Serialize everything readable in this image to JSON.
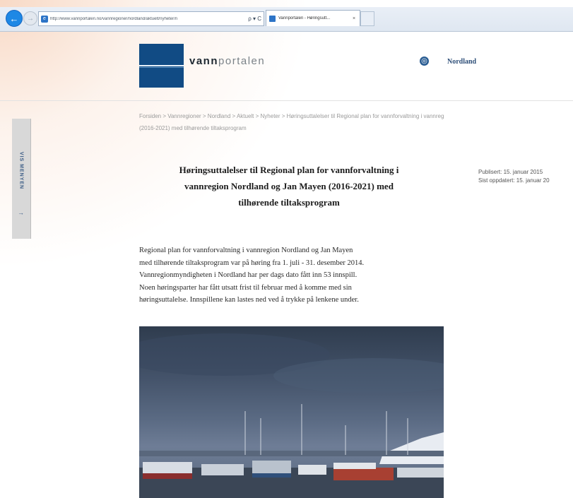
{
  "browser": {
    "url": "http://www.vannportalen.no/vannregioner/nordland/aktuelt/nyheter/n",
    "address_controls": "ρ ▾ C",
    "tab_title": "Vannportalen - Høringsutt...",
    "tab_close": "×"
  },
  "site": {
    "logo_bold": "vann",
    "logo_light": "portalen",
    "region": "Nordland"
  },
  "breadcrumb": {
    "line1": "Forsiden  >  Vannregioner  >  Nordland  >  Aktuelt  >  Nyheter  >  Høringsuttalelser til Regional plan for vannforvaltning i vannreg",
    "line2": "(2016-2021) med tilhørende tiltaksprogram"
  },
  "side_menu": {
    "label": "VIS MENYEN",
    "arrow": "→"
  },
  "article": {
    "title_lines": [
      "Høringsuttalelser til Regional plan for vannforvaltning i",
      "vannregion Nordland og Jan Mayen (2016-2021) med",
      "tilhørende tiltaksprogram"
    ],
    "published": "Publisert: 15. januar 2015",
    "updated": "Sist oppdatert: 15. januar 20",
    "body_lines": [
      "Regional plan for vannforvaltning i vannregion Nordland og Jan Mayen",
      "med tilhørende tiltaksprogram var på høring fra 1. juli - 31. desember 2014.",
      "Vannregionmyndigheten i Nordland har per dags dato fått inn 53 innspill.",
      "Noen høringsparter har fått utsatt frist til februar med å komme med sin",
      "høringsuttalelse. Innspillene kan lastes ned ved å trykke på lenkene under."
    ]
  },
  "colors": {
    "logo_blue": "#114b84",
    "side_menu_text": "#3a5b85",
    "back_button": "#1e88e5"
  },
  "icons": {
    "back": "back-arrow-icon",
    "forward": "forward-arrow-icon",
    "globe": "globe-icon",
    "browser": "ie-icon"
  }
}
